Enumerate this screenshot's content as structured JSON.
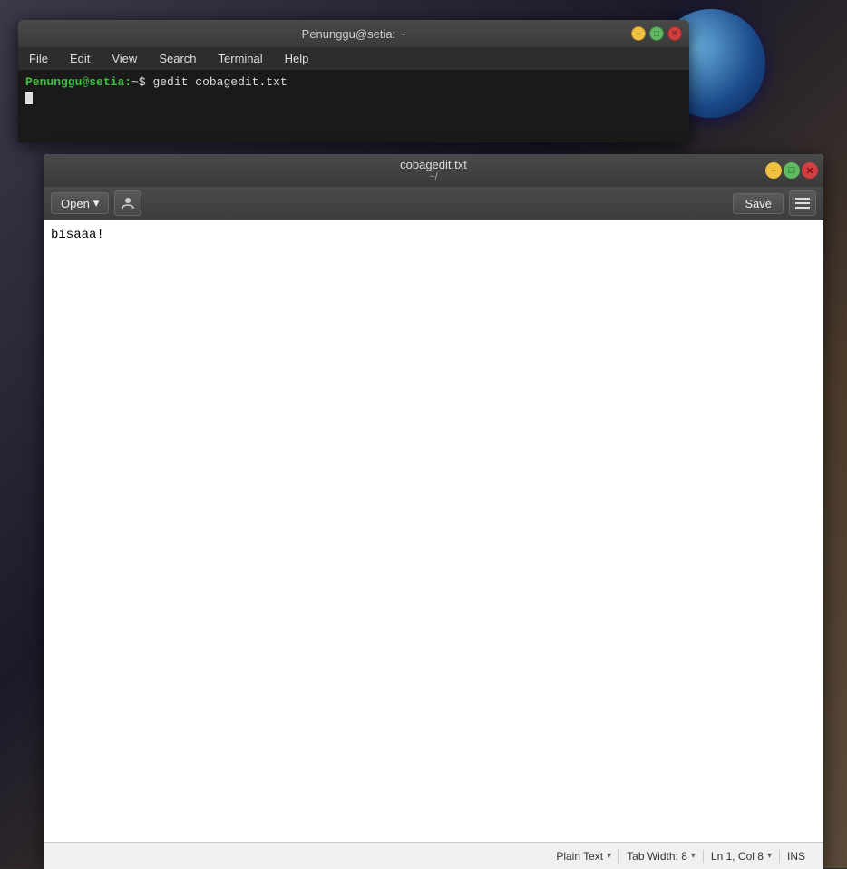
{
  "desktop": {
    "bg_color": "#2a2a2a"
  },
  "terminal": {
    "title": "Penunggu@setia: ~",
    "controls": {
      "minimize": "–",
      "maximize": "□",
      "close": "✕"
    },
    "menu": {
      "items": [
        "File",
        "Edit",
        "View",
        "Search",
        "Terminal",
        "Help"
      ]
    },
    "prompt_user": "Penunggu@setia:",
    "prompt_dir": "~",
    "prompt_symbol": "$",
    "command": " gedit cobagedit.txt"
  },
  "gedit": {
    "title_filename": "cobagedit.txt",
    "title_path": "~/",
    "controls": {
      "minimize": "–",
      "maximize": "□",
      "close": "✕"
    },
    "toolbar": {
      "open_label": "Open",
      "open_arrow": "▾",
      "save_label": "Save"
    },
    "editor": {
      "content": "bisaaa!"
    },
    "statusbar": {
      "plain_text_label": "Plain Text",
      "tab_width_label": "Tab Width: 8",
      "cursor_position": "Ln 1, Col 8",
      "ins_label": "INS"
    }
  }
}
